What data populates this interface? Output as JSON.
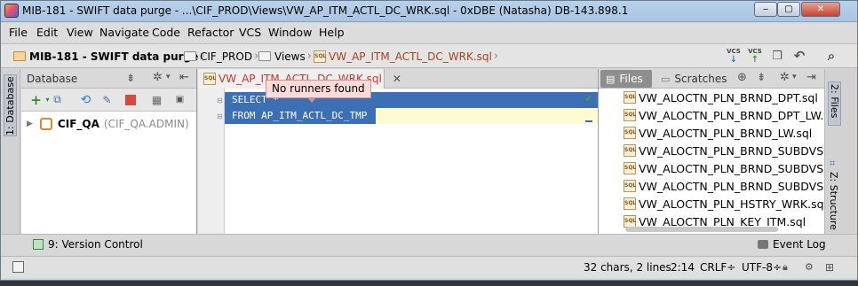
{
  "window": {
    "title": "MIB-181 - SWIFT data purge - ...\\CIF_PROD\\Views\\VW_AP_ITM_ACTL_DC_WRK.sql - 0xDBE (Natasha) DB-143.898.1",
    "minimize": "‒",
    "maximize": "▢",
    "close": "✕"
  },
  "menu": [
    "File",
    "Edit",
    "View",
    "Navigate",
    "Code",
    "Refactor",
    "VCS",
    "Window",
    "Help"
  ],
  "breadcrumbs": [
    "MIB-181 - SWIFT data purge",
    "CIF_PROD",
    "Views",
    "VW_AP_ITM_ACTL_DC_WRK.sql"
  ],
  "toolbar": {
    "vcs1": "VCS",
    "vcs2": "VCS"
  },
  "left_stripe": {
    "database": "1: Database"
  },
  "right_stripe": {
    "files": "2: Files",
    "structure": "Z: Structure"
  },
  "database_panel": {
    "title": "Database",
    "tree": [
      {
        "name": "CIF_QA",
        "detail": "(CIF_QA.ADMIN)"
      }
    ]
  },
  "editor": {
    "tab": "VW_AP_ITM_ACTL_DC_WRK.sql",
    "tooltip": "No runners found",
    "lines": [
      "SELECT *",
      "FROM AP_ITM_ACTL_DC_TMP"
    ]
  },
  "files_panel": {
    "tabs": [
      "Files",
      "Scratches"
    ],
    "items": [
      "VW_ALOCTN_PLN_BRND_DPT.sql",
      "VW_ALOCTN_PLN_BRND_DPT_LW.sql",
      "VW_ALOCTN_PLN_BRND_LW.sql",
      "VW_ALOCTN_PLN_BRND_SUBDVSN.sql",
      "VW_ALOCTN_PLN_BRND_SUBDVSN_L",
      "VW_ALOCTN_PLN_BRND_SUBDVSN_V",
      "VW_ALOCTN_PLN_HSTRY_WRK.sql",
      "VW_ALOCTN_PLN_KEY_ITM.sql"
    ]
  },
  "bottom_tools": {
    "version_control": "9: Version Control",
    "event_log": "Event Log"
  },
  "status": {
    "chars": "32 chars, 2 lines",
    "position": "2:14",
    "line_ending": "CRLF÷",
    "encoding": "UTF-8÷"
  }
}
